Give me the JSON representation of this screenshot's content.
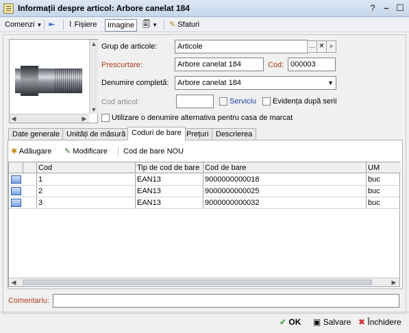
{
  "window": {
    "title": "Informații despre articol: Arbore canelat 184"
  },
  "toolbar": {
    "commands_label": "Comenzi",
    "files_label": "Fișiere",
    "image_label": "Imagine",
    "tips_label": "Sfaturi"
  },
  "form": {
    "group_label": "Grup de articole:",
    "group_value": "Articole",
    "short_label": "Prescurtare:",
    "short_value": "Arbore canelat 184",
    "code_label": "Cod:",
    "code_value": "000003",
    "fullname_label": "Denumire completă:",
    "fullname_value": "Arbore canelat 184",
    "article_code_label": "Cod articol:",
    "article_code_value": "",
    "service_label": "Serviciu",
    "series_label": "Evidența după serii",
    "alt_name_label": "Utilizare o denumire alternativa pentru casa de marcat"
  },
  "tabs": [
    {
      "label": "Date generale"
    },
    {
      "label": "Unități de măsură"
    },
    {
      "label": "Coduri de bare"
    },
    {
      "label": "Prețuri"
    },
    {
      "label": "Descrierea"
    }
  ],
  "active_tab_index": 2,
  "barcodes": {
    "add_label": "Adăugare",
    "edit_label": "Modificare",
    "new_label": "Cod de bare NOU",
    "columns": [
      "Cod",
      "Tip de cod de bare",
      "Cod de bare",
      "UM"
    ],
    "rows": [
      {
        "cod": "1",
        "tip": "EAN13",
        "barcode": "9000000000018",
        "um": "buc"
      },
      {
        "cod": "2",
        "tip": "EAN13",
        "barcode": "9000000000025",
        "um": "buc"
      },
      {
        "cod": "3",
        "tip": "EAN13",
        "barcode": "9000000000032",
        "um": "buc"
      }
    ]
  },
  "comment": {
    "label": "Comentariu:",
    "value": ""
  },
  "footer": {
    "ok_label": "OK",
    "save_label": "Salvare",
    "close_label": "Închidere"
  },
  "colors": {
    "accent_red": "#b03a1a",
    "link_blue": "#1a3f9c",
    "ok_green": "#2e9a2e",
    "close_red": "#d22a2a"
  }
}
